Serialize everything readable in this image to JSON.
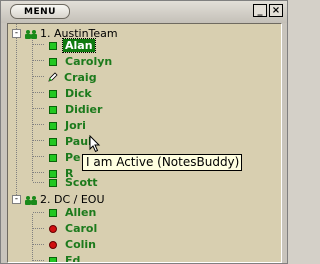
{
  "titlebar": {
    "menu_label": "MENU",
    "minimize_label": "_",
    "close_label": "×"
  },
  "groups": [
    {
      "label": "1. AustinTeam",
      "expanded": true,
      "members": [
        {
          "name": "Alan",
          "status": "online",
          "selected": true
        },
        {
          "name": "Carolyn",
          "status": "online"
        },
        {
          "name": "Craig",
          "status": "pending"
        },
        {
          "name": "Dick",
          "status": "online"
        },
        {
          "name": "Didier",
          "status": "online"
        },
        {
          "name": "Jori",
          "status": "online"
        },
        {
          "name": "Paul",
          "status": "online"
        },
        {
          "name": "Pe",
          "status": "online"
        },
        {
          "name": "R",
          "status": "online"
        },
        {
          "name": "Scott",
          "status": "online"
        }
      ]
    },
    {
      "label": "2. DC / EOU",
      "expanded": true,
      "members": [
        {
          "name": "Allen",
          "status": "online"
        },
        {
          "name": "Carol",
          "status": "busy"
        },
        {
          "name": "Colin",
          "status": "busy"
        },
        {
          "name": "Ed",
          "status": "online"
        }
      ]
    }
  ],
  "tooltip": {
    "text": "I am Active (NotesBuddy)"
  },
  "colors": {
    "list_background": "#d8cfb0",
    "online_name": "#1c7a1c",
    "selected_background": "#0f7a10",
    "tooltip_background": "#ffffe1"
  },
  "icons": {
    "menu": "menu-button",
    "minimize": "minimize-icon",
    "close": "close-icon",
    "group": "people-group-icon",
    "online": "green-square-icon",
    "busy": "red-circle-icon",
    "pending": "pen-icon"
  }
}
